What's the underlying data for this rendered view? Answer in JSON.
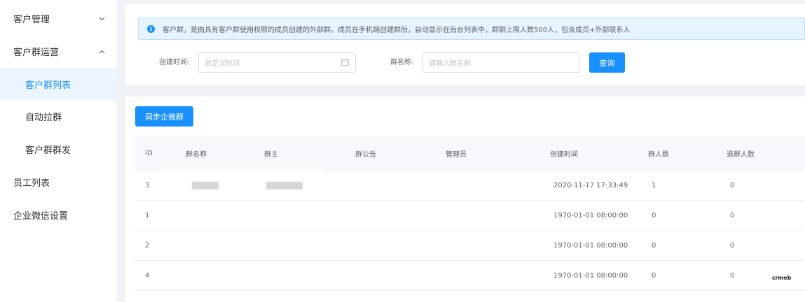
{
  "sidebar": {
    "items": [
      {
        "label": "客户管理",
        "chevron": "down"
      },
      {
        "label": "客户群运营",
        "chevron": "up"
      },
      {
        "label": "客户群列表",
        "active": true
      },
      {
        "label": "自动拉群"
      },
      {
        "label": "客户群群发"
      },
      {
        "label": "员工列表"
      },
      {
        "label": "企业微信设置"
      }
    ]
  },
  "alert": {
    "icon": "info-icon",
    "text": "客户群，是由具有客户群使用权限的成员创建的外部群。成员在手机端创建群后，自动显示在后台列表中，群聊上限人数500人，包含成员+外部联系人"
  },
  "filters": {
    "created_time_label": "创建时间:",
    "created_time_placeholder": "自定义时间",
    "group_name_label": "群名称:",
    "group_name_placeholder": "请输入群名称",
    "query_label": "查询"
  },
  "toolbar": {
    "sync_label": "同步企微群"
  },
  "table": {
    "headers": [
      "ID",
      "群名称",
      "群主",
      "群公告",
      "管理员",
      "创建时间",
      "群人数",
      "退群人数"
    ],
    "rows": [
      {
        "id": "3",
        "created": "2020-11-17 17:33:49",
        "members": "1",
        "quit": "0",
        "blurred": true
      },
      {
        "id": "1",
        "created": "1970-01-01 08:00:00",
        "members": "0",
        "quit": "0"
      },
      {
        "id": "2",
        "created": "1970-01-01 08:00:00",
        "members": "0",
        "quit": "0"
      },
      {
        "id": "4",
        "created": "1970-01-01 08:00:00",
        "members": "0",
        "quit": "0"
      }
    ]
  },
  "watermark": "crmeb",
  "colors": {
    "primary": "#1890ff",
    "active_bg": "#ecf5ff",
    "alert_bg": "#e6f4ff",
    "page_bg": "#f0f2f5"
  }
}
